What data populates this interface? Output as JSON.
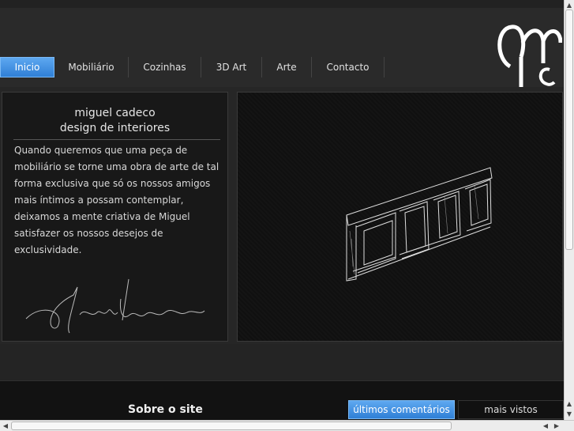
{
  "nav": {
    "items": [
      {
        "label": "Inicio",
        "active": true
      },
      {
        "label": "Mobiliário",
        "active": false
      },
      {
        "label": "Cozinhas",
        "active": false
      },
      {
        "label": "3D Art",
        "active": false
      },
      {
        "label": "Arte",
        "active": false
      },
      {
        "label": "Contacto",
        "active": false
      }
    ]
  },
  "intro": {
    "title_line1": "miguel cadeco",
    "title_line2": "design de interiores",
    "text": "Quando queremos que uma peça de mobiliário se torne uma obra de arte de tal forma exclusiva que só os nossos amigos mais íntimos a possam contemplar, deixamos a mente criativa de Miguel satisfazer os nossos desejos de exclusividade."
  },
  "footer": {
    "heading": "Sobre o site",
    "tabs": [
      "últimos comentários",
      "mais vistos"
    ]
  },
  "colors": {
    "accent": "#3a8ee6",
    "background": "#1a1a1a"
  },
  "icons": [
    "logo-mc",
    "signature-image",
    "furniture-sketch-image",
    "scroll-up-arrow",
    "scroll-down-arrow",
    "scroll-left-arrow",
    "scroll-right-arrow"
  ]
}
